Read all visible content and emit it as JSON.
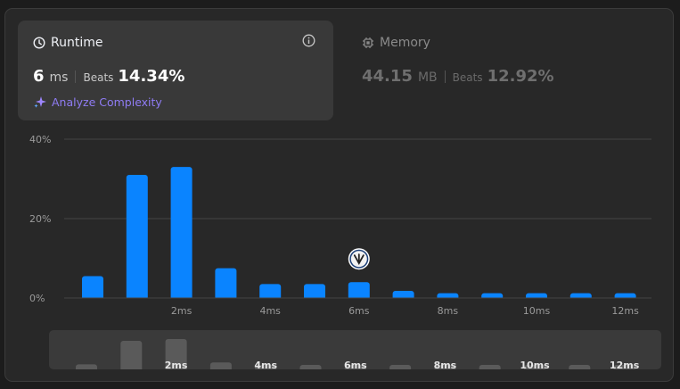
{
  "runtime": {
    "title": "Runtime",
    "value": "6",
    "unit": "ms",
    "beats_label": "Beats",
    "beats_value": "14.34%",
    "analyze_label": "Analyze Complexity"
  },
  "memory": {
    "title": "Memory",
    "value": "44.15",
    "unit": "MB",
    "beats_label": "Beats",
    "beats_value": "12.92%"
  },
  "colors": {
    "bar": "#0a84ff",
    "overview_bar": "#5a5a5a",
    "accent_purple": "#8f7cf4"
  },
  "chart_data": {
    "type": "bar",
    "categories": [
      "",
      "",
      "2ms",
      "",
      "4ms",
      "",
      "6ms",
      "",
      "8ms",
      "",
      "10ms",
      "",
      "12ms"
    ],
    "values": [
      5.5,
      31,
      33,
      7.5,
      3.5,
      3.5,
      4,
      1.8,
      1.2,
      1.2,
      1.2,
      1.2,
      1.2
    ],
    "ylim": [
      0,
      40
    ],
    "yticks": [
      {
        "value": 0,
        "label": "0%"
      },
      {
        "value": 20,
        "label": "20%"
      },
      {
        "value": 40,
        "label": "40%"
      }
    ],
    "marker_index": 6,
    "marker_icon": "user-avatar-icon",
    "grid": true
  }
}
